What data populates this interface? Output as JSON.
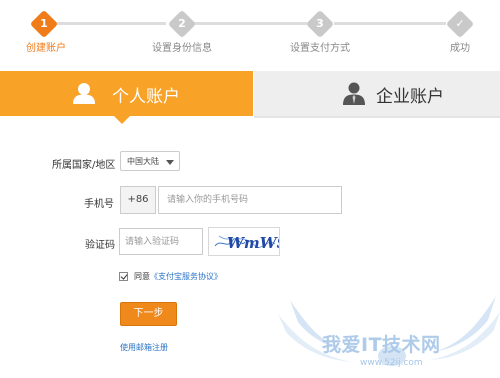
{
  "stepper": {
    "steps": [
      {
        "number": "1",
        "label": "创建账户",
        "active": true
      },
      {
        "number": "2",
        "label": "设置身份信息",
        "active": false
      },
      {
        "number": "3",
        "label": "设置支付方式",
        "active": false
      },
      {
        "number": "✓",
        "label": "成功",
        "active": false
      }
    ],
    "active_color": "#f07b19",
    "inactive_color": "#c9c9c9"
  },
  "tabs": {
    "personal": {
      "label": "个人账户",
      "selected": true
    },
    "enterprise": {
      "label": "企业账户",
      "selected": false
    }
  },
  "form": {
    "country": {
      "label": "所属国家/地区",
      "value": "中国大陆"
    },
    "phone": {
      "label": "手机号",
      "prefix": "+86",
      "placeholder": "请输入你的手机号码",
      "value": ""
    },
    "captcha": {
      "label": "验证码",
      "placeholder": "请输入验证码",
      "value": "",
      "image_text": "WmWS"
    },
    "agreement": {
      "checked": true,
      "text": "同意",
      "link": "《支付宝服务协议》"
    },
    "next_button": "下一步",
    "email_register": "使用邮箱注册"
  },
  "watermark": {
    "text": "我爱IT技术网",
    "url": "www.52ij.com"
  },
  "colors": {
    "accent": "#f8a227",
    "button": "#f0891c",
    "link": "#2a74c7"
  }
}
